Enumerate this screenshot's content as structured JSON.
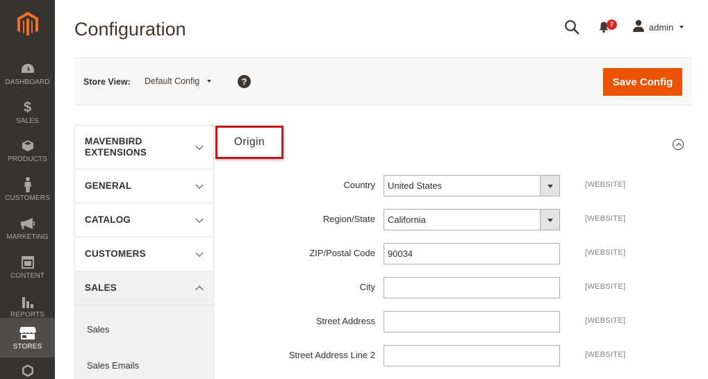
{
  "app": {
    "page_title": "Configuration"
  },
  "header": {
    "notification_count": "7",
    "user_name": "admin"
  },
  "menu": {
    "items": [
      {
        "label": "DASHBOARD",
        "icon": "dashboard-icon"
      },
      {
        "label": "SALES",
        "icon": "dollar-icon"
      },
      {
        "label": "PRODUCTS",
        "icon": "box-icon"
      },
      {
        "label": "CUSTOMERS",
        "icon": "person-icon"
      },
      {
        "label": "MARKETING",
        "icon": "megaphone-icon"
      },
      {
        "label": "CONTENT",
        "icon": "layout-icon"
      },
      {
        "label": "REPORTS",
        "icon": "bar-chart-icon"
      },
      {
        "label": "STORES",
        "icon": "store-icon",
        "active": true
      }
    ]
  },
  "store_view": {
    "label": "Store View:",
    "value": "Default Config",
    "help": "?"
  },
  "toolbar": {
    "save_label": "Save Config"
  },
  "tabs": {
    "items": [
      {
        "label": "MAVENBIRD EXTENSIONS"
      },
      {
        "label": "GENERAL"
      },
      {
        "label": "CATALOG"
      },
      {
        "label": "CUSTOMERS"
      },
      {
        "label": "SALES",
        "open": true
      }
    ],
    "sales_subitems": [
      "Sales",
      "Sales Emails"
    ]
  },
  "section": {
    "title": "Origin",
    "fields": [
      {
        "label": "Country",
        "type": "select",
        "value": "United States",
        "scope": "[WEBSITE]"
      },
      {
        "label": "Region/State",
        "type": "select",
        "value": "California",
        "scope": "[WEBSITE]"
      },
      {
        "label": "ZIP/Postal Code",
        "type": "text",
        "value": "90034",
        "scope": "[WEBSITE]"
      },
      {
        "label": "City",
        "type": "text",
        "value": "",
        "scope": "[WEBSITE]"
      },
      {
        "label": "Street Address",
        "type": "text",
        "value": "",
        "scope": "[WEBSITE]"
      },
      {
        "label": "Street Address Line 2",
        "type": "text",
        "value": "",
        "scope": "[WEBSITE]"
      }
    ]
  },
  "colors": {
    "menu_bg": "#373330",
    "accent": "#eb5202",
    "highlight_border": "#c5171b"
  }
}
